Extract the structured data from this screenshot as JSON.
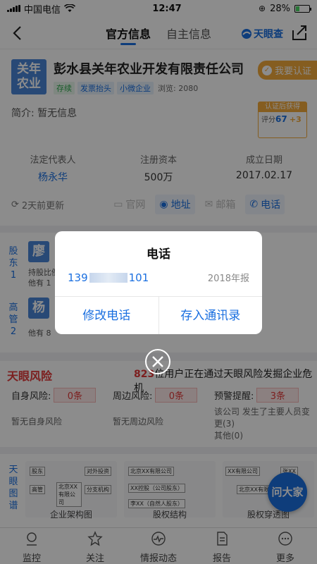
{
  "status": {
    "carrier": "中国电信",
    "time": "12:47",
    "battery": "28%"
  },
  "nav": {
    "tab_official": "官方信息",
    "tab_self": "自主信息",
    "brand": "天眼查"
  },
  "company": {
    "logo_line1": "关年",
    "logo_line2": "农业",
    "name": "彭水县关年农业开发有限责任公司",
    "tags": [
      "存续",
      "发票抬头",
      "小微企业"
    ],
    "views": "浏览: 2080",
    "cert_label": "我要认证",
    "intro": "简介:  暂无信息",
    "score_head": "认证后获得",
    "score_label": "评分",
    "score_value": "67",
    "score_up": "+3"
  },
  "stats": [
    {
      "label": "法定代表人",
      "value": "杨永华"
    },
    {
      "label": "注册资本",
      "value": "500万"
    },
    {
      "label": "成立日期",
      "value": "2017.02.17"
    }
  ],
  "actions": {
    "updated": "2天前更新",
    "website": "官网",
    "address": "地址",
    "email": "邮箱",
    "phone": "电话"
  },
  "people": {
    "shareholder_label": "股东 1",
    "exec_label": "高管 2",
    "sh_avatar": "廖",
    "sh_line1": "持股比例",
    "sh_line2": "他有 1",
    "ex_avatar": "杨",
    "ex_line": "他有 8"
  },
  "risk": {
    "title": "天眼风险",
    "count": "823",
    "headline": "位用户正在通过天眼风险发掘企业危机",
    "self_label": "自身风险:",
    "self_val": "0条",
    "self_sub": "暂无自身风险",
    "around_label": "周边风险:",
    "around_val": "0条",
    "around_sub": "暂无周边风险",
    "warn_label": "预警提醒:",
    "warn_val": "3条",
    "warn_sub1": "该公司 发生了主要人员变",
    "warn_sub2": "更(3)",
    "warn_sub3": "其他(0)"
  },
  "graphs": {
    "side": "天眼图谱",
    "g1": "企业架构图",
    "g2": "股权结构",
    "g3": "股权穿透图",
    "g1_items": [
      "股东",
      "对外投资",
      "高管",
      "北京XX有限公司",
      "分支机构"
    ],
    "g2_items": [
      "北京XX有限公司",
      "XX控股（公司股东）",
      "李XX（自然人股东）"
    ],
    "g3_items": [
      "XX有限公司",
      "张XX",
      "北京XX有限公司"
    ]
  },
  "ask_label": "问大家",
  "tabbar": [
    "监控",
    "关注",
    "情报动态",
    "报告",
    "更多"
  ],
  "dialog": {
    "title": "电话",
    "phone_prefix": "139",
    "phone_suffix": "101",
    "report": "2018年报",
    "edit": "修改电话",
    "save": "存入通讯录"
  }
}
